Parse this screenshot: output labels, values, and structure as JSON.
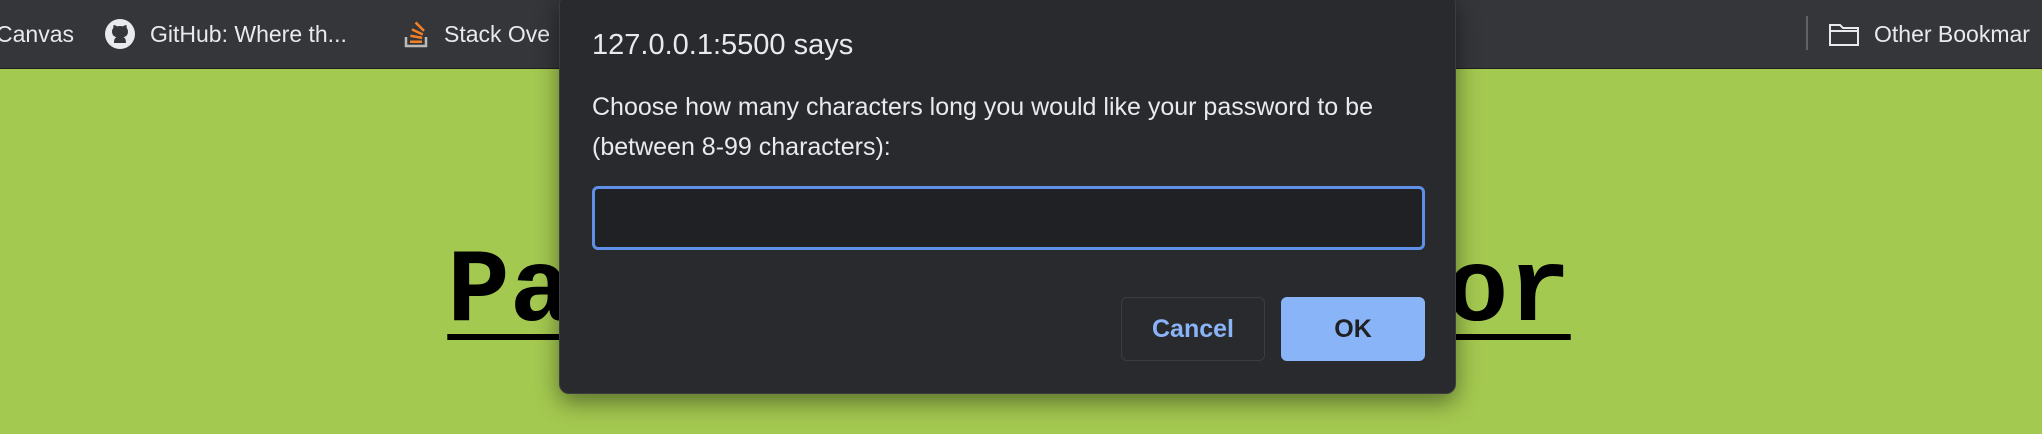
{
  "bookmarks_bar": {
    "items": [
      {
        "label": "Canvas",
        "icon": "canvas-icon"
      },
      {
        "label": "GitHub: Where th...",
        "icon": "github-icon"
      },
      {
        "label": "Stack Ove",
        "icon": "stack-overflow-icon"
      }
    ],
    "other_bookmarks": {
      "label": "Other Bookmar",
      "icon": "folder-icon"
    }
  },
  "page": {
    "heading_visible_left": "Pa",
    "heading_visible_right": "or"
  },
  "dialog": {
    "title": "127.0.0.1:5500 says",
    "message": "Choose how many characters long you would like your password to be (between 8-99 characters):",
    "input_value": "",
    "cancel_label": "Cancel",
    "ok_label": "OK"
  },
  "colors": {
    "page_background": "#a4c950",
    "bookmarks_bar": "#35363a",
    "dialog_background": "#292a2d",
    "accent": "#8ab4f8",
    "input_focus_border": "#5f8fe6"
  }
}
